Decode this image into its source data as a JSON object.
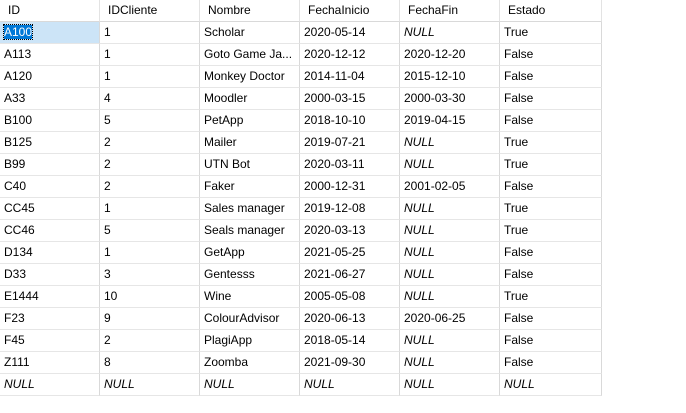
{
  "columns": [
    "ID",
    "IDCliente",
    "Nombre",
    "FechaInicio",
    "FechaFin",
    "Estado"
  ],
  "rows": [
    [
      "A100",
      "1",
      "Scholar",
      "2020-05-14",
      "NULL",
      "True"
    ],
    [
      "A113",
      "1",
      "Goto Game Ja...",
      "2020-12-12",
      "2020-12-20",
      "False"
    ],
    [
      "A120",
      "1",
      "Monkey Doctor",
      "2014-11-04",
      "2015-12-10",
      "False"
    ],
    [
      "A33",
      "4",
      "Moodler",
      "2000-03-15",
      "2000-03-30",
      "False"
    ],
    [
      "B100",
      "5",
      "PetApp",
      "2018-10-10",
      "2019-04-15",
      "False"
    ],
    [
      "B125",
      "2",
      "Mailer",
      "2019-07-21",
      "NULL",
      "True"
    ],
    [
      "B99",
      "2",
      "UTN Bot",
      "2020-03-11",
      "NULL",
      "True"
    ],
    [
      "C40",
      "2",
      "Faker",
      "2000-12-31",
      "2001-02-05",
      "False"
    ],
    [
      "CC45",
      "1",
      "Sales manager",
      "2019-12-08",
      "NULL",
      "True"
    ],
    [
      "CC46",
      "5",
      "Seals manager",
      "2020-03-13",
      "NULL",
      "True"
    ],
    [
      "D134",
      "1",
      "GetApp",
      "2021-05-25",
      "NULL",
      "False"
    ],
    [
      "D33",
      "3",
      "Gentesss",
      "2021-06-27",
      "NULL",
      "False"
    ],
    [
      "E1444",
      "10",
      "Wine",
      "2005-05-08",
      "NULL",
      "True"
    ],
    [
      "F23",
      "9",
      "ColourAdvisor",
      "2020-06-13",
      "2020-06-25",
      "False"
    ],
    [
      "F45",
      "2",
      "PlagiApp",
      "2018-05-14",
      "NULL",
      "False"
    ],
    [
      "Z111",
      "8",
      "Zoomba",
      "2021-09-30",
      "NULL",
      "False"
    ],
    [
      "NULL",
      "NULL",
      "NULL",
      "NULL",
      "NULL",
      "NULL"
    ]
  ],
  "selection": {
    "row": 0,
    "col": 0
  },
  "colors": {
    "selection_bg": "#0078d7",
    "selection_text": "#ffffff",
    "gridline": "#d9d9d9"
  }
}
